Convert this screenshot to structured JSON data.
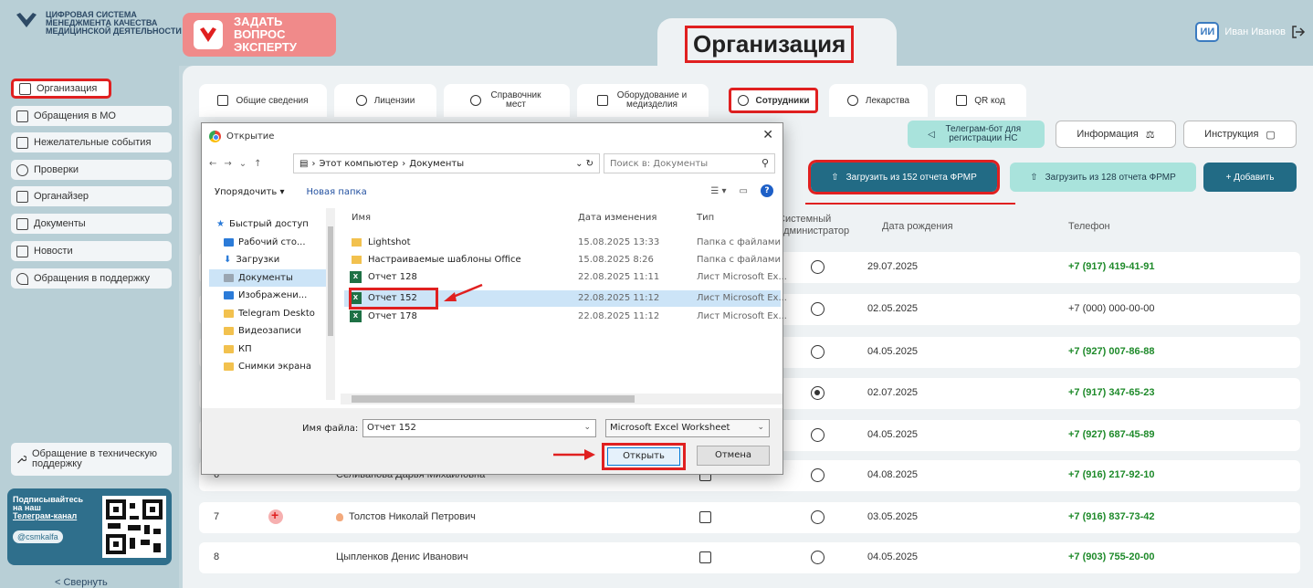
{
  "app": {
    "logo_text": "ЦИФРОВАЯ СИСТЕМА МЕНЕДЖМЕНТА КАЧЕСТВА МЕДИЦИНСКОЙ ДЕЯТЕЛЬНОСТИ",
    "ask_expert": "ЗАДАТЬ ВОПРОС ЭКСПЕРТУ",
    "page_title": "Организация",
    "user_initials": "ИИ",
    "user_name": "Иван Иванов"
  },
  "sidebar": {
    "items": [
      {
        "label": "Организация",
        "icon": "building-icon"
      },
      {
        "label": "Обращения в МО",
        "icon": "chat-icon"
      },
      {
        "label": "Нежелательные события",
        "icon": "alert-icon"
      },
      {
        "label": "Проверки",
        "icon": "search-icon"
      },
      {
        "label": "Органайзер",
        "icon": "calendar-icon"
      },
      {
        "label": "Документы",
        "icon": "documents-icon"
      },
      {
        "label": "Новости",
        "icon": "news-icon"
      },
      {
        "label": "Обращения в поддержку",
        "icon": "heart-icon"
      }
    ],
    "tech_support": "Обращение в техническую поддержку",
    "tg_line1": "Подписывайтесь на наш",
    "tg_link": "Телеграм-канал",
    "tg_handle": "@csmkalfa",
    "collapse": "< Свернуть"
  },
  "tabs": [
    {
      "label": "Общие сведения"
    },
    {
      "label": "Лицензии"
    },
    {
      "label": "Справочник мест"
    },
    {
      "label": "Оборудование и медизделия"
    },
    {
      "label": "Сотрудники"
    },
    {
      "label": "Лекарства"
    },
    {
      "label": "QR код"
    }
  ],
  "actions": {
    "telegram_bot": "Телеграм-бот для регистрации НС",
    "info": "Информация",
    "instruction": "Инструкция",
    "upload_152": "Загрузить из 152 отчета ФРМР",
    "upload_128": "Загрузить из 128 отчета ФРМР",
    "add": "+  Добавить"
  },
  "table": {
    "headers": {
      "sysadmin": "Системный администратор",
      "birth": "Дата рождения",
      "phone": "Телефон"
    },
    "rows": [
      {
        "num": "",
        "name": "",
        "birth": "29.07.2025",
        "phone": "+7 (917) 419-41-91",
        "admin": false,
        "bold": true
      },
      {
        "num": "",
        "name": "",
        "birth": "02.05.2025",
        "phone": "+7 (000) 000-00-00",
        "admin": false,
        "bold": false
      },
      {
        "num": "",
        "name": "",
        "birth": "04.05.2025",
        "phone": "+7 (927) 007-86-88",
        "admin": false,
        "bold": true
      },
      {
        "num": "",
        "name": "",
        "birth": "02.07.2025",
        "phone": "+7 (917) 347-65-23",
        "admin": true,
        "bold": true
      },
      {
        "num": "",
        "name": "",
        "birth": "04.05.2025",
        "phone": "+7 (927) 687-45-89",
        "admin": false,
        "bold": true
      },
      {
        "num": "6",
        "name": "Селиванова Дарья Михайловна",
        "birth": "04.08.2025",
        "phone": "+7 (916) 217-92-10",
        "admin": false,
        "bold": true
      },
      {
        "num": "7",
        "name": "Толстов Николай Петрович",
        "birth": "03.05.2025",
        "phone": "+7 (916) 837-73-42",
        "admin": false,
        "bold": true
      },
      {
        "num": "8",
        "name": "Цыпленков Денис Иванович",
        "birth": "04.05.2025",
        "phone": "+7 (903) 755-20-00",
        "admin": false,
        "bold": true
      }
    ]
  },
  "dialog": {
    "title": "Открытие",
    "path_root": "Этот компьютер",
    "path_current": "Документы",
    "search_placeholder": "Поиск в: Документы",
    "organize": "Упорядочить ▾",
    "new_folder": "Новая папка",
    "nav": [
      {
        "label": "Быстрый доступ",
        "icon": "star-icon"
      },
      {
        "label": "Рабочий сто...",
        "icon": "desktop-icon"
      },
      {
        "label": "Загрузки",
        "icon": "download-icon"
      },
      {
        "label": "Документы",
        "icon": "documents-icon"
      },
      {
        "label": "Изображени...",
        "icon": "pictures-icon"
      },
      {
        "label": "Telegram Deskto",
        "icon": "folder-icon"
      },
      {
        "label": "Видеозаписи",
        "icon": "folder-icon"
      },
      {
        "label": "КП",
        "icon": "folder-icon"
      },
      {
        "label": "Снимки экрана",
        "icon": "folder-icon"
      }
    ],
    "columns": {
      "name": "Имя",
      "modified": "Дата изменения",
      "type": "Тип"
    },
    "files": [
      {
        "name": "Lightshot",
        "date": "15.08.2025 13:33",
        "type": "Папка с файлами",
        "kind": "folder"
      },
      {
        "name": "Настраиваемые шаблоны Office",
        "date": "15.08.2025 8:26",
        "type": "Папка с файлами",
        "kind": "folder"
      },
      {
        "name": "Отчет 128",
        "date": "22.08.2025 11:11",
        "type": "Лист Microsoft Ex...",
        "kind": "xlsx"
      },
      {
        "name": "Отчет 152",
        "date": "22.08.2025 11:12",
        "type": "Лист Microsoft Ex...",
        "kind": "xlsx"
      },
      {
        "name": "Отчет 178",
        "date": "22.08.2025 11:12",
        "type": "Лист Microsoft Ex...",
        "kind": "xlsx"
      }
    ],
    "filename_label": "Имя файла:",
    "filename_value": "Отчет 152",
    "file_type": "Microsoft Excel Worksheet",
    "open": "Открыть",
    "cancel": "Отмена"
  },
  "colors": {
    "accent": "#226b85",
    "highlight": "#e02020",
    "phone": "#1e8a2a"
  }
}
